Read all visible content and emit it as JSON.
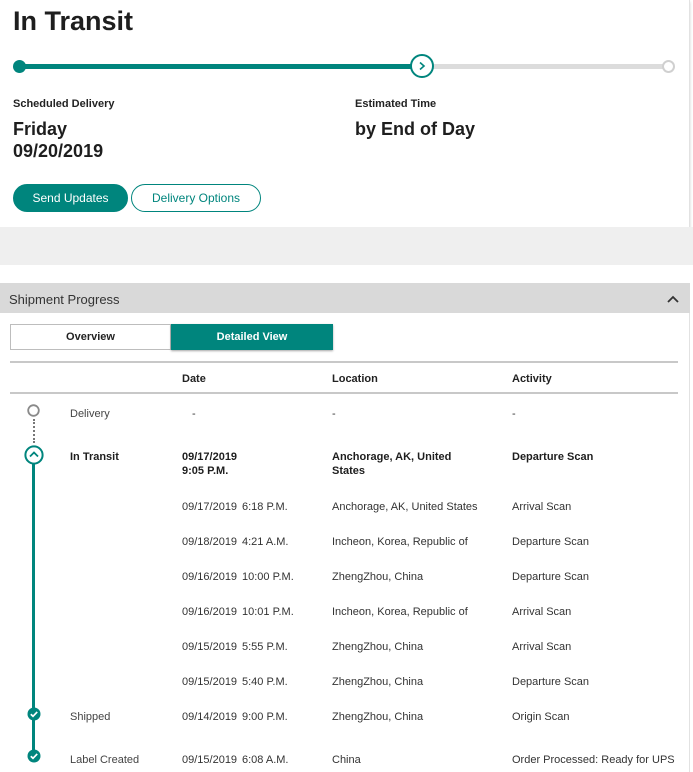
{
  "status": {
    "title": "In Transit",
    "progress_fraction": 0.62
  },
  "delivery": {
    "scheduled_label": "Scheduled Delivery",
    "scheduled_day": "Friday",
    "scheduled_date": "09/20/2019",
    "estimated_label": "Estimated Time",
    "estimated_value": "by End of Day"
  },
  "actions": {
    "send_updates": "Send Updates",
    "delivery_options": "Delivery Options"
  },
  "panel": {
    "title": "Shipment Progress",
    "tabs": [
      {
        "label": "Overview",
        "active": false
      },
      {
        "label": "Detailed View",
        "active": true
      }
    ],
    "columns": [
      "Date",
      "Location",
      "Activity"
    ]
  },
  "rows": [
    {
      "status": "Delivery",
      "date": "-",
      "time": "",
      "location": "-",
      "activity": "-"
    },
    {
      "status": "In Transit",
      "date": "09/17/2019",
      "time": "9:05 P.M.",
      "location": "Anchorage, AK, United States",
      "activity": "Departure Scan"
    },
    {
      "status": "",
      "date": "09/17/2019",
      "time": "6:18 P.M.",
      "location": "Anchorage, AK, United States",
      "activity": "Arrival Scan"
    },
    {
      "status": "",
      "date": "09/18/2019",
      "time": "4:21 A.M.",
      "location": "Incheon, Korea, Republic of",
      "activity": "Departure Scan"
    },
    {
      "status": "",
      "date": "09/16/2019",
      "time": "10:00 P.M.",
      "location": "ZhengZhou, China",
      "activity": "Departure Scan"
    },
    {
      "status": "",
      "date": "09/16/2019",
      "time": "10:01 P.M.",
      "location": "Incheon, Korea, Republic of",
      "activity": "Arrival Scan"
    },
    {
      "status": "",
      "date": "09/15/2019",
      "time": "5:55 P.M.",
      "location": "ZhengZhou, China",
      "activity": "Arrival Scan"
    },
    {
      "status": "",
      "date": "09/15/2019",
      "time": "5:40 P.M.",
      "location": "ZhengZhou, China",
      "activity": "Departure Scan"
    },
    {
      "status": "Shipped",
      "date": "09/14/2019",
      "time": "9:00 P.M.",
      "location": "ZhengZhou, China",
      "activity": "Origin Scan"
    },
    {
      "status": "Label Created",
      "date": "09/15/2019",
      "time": "6:08 A.M.",
      "location": "China",
      "activity": "Order Processed: Ready for UPS"
    }
  ],
  "colors": {
    "accent": "#00857d",
    "track": "#dcdcdc",
    "header_band": "#d9d9d9"
  },
  "icons": {
    "current_step": "chevron-right-icon",
    "collapse": "chevron-up-icon",
    "completed": "check-circle-icon",
    "pending": "empty-circle-icon"
  }
}
